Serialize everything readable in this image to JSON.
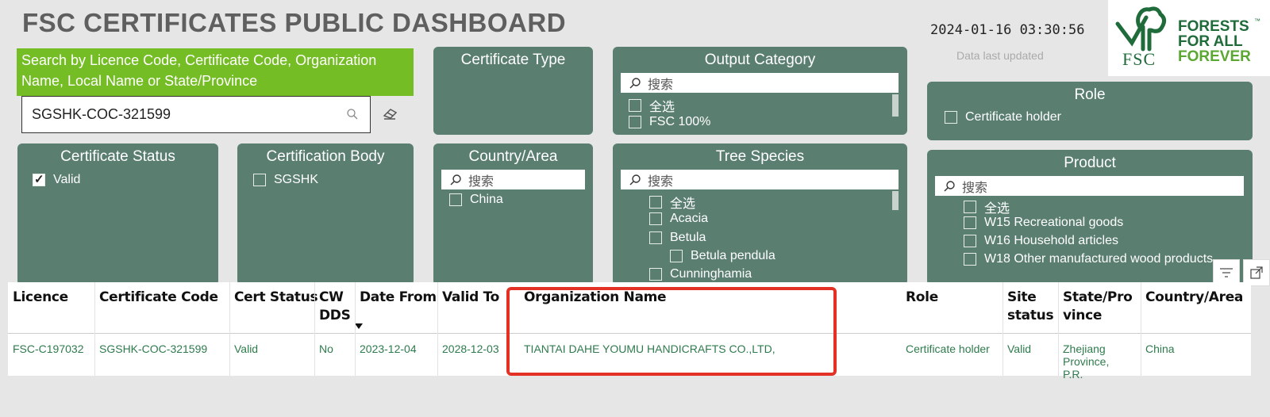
{
  "header": {
    "title": "FSC CERTIFICATES PUBLIC DASHBOARD",
    "timestamp": "2024-01-16 03:30:56",
    "updated_label": "Data last updated"
  },
  "logo": {
    "fsc": "FSC",
    "slogan_1": "FORESTS",
    "slogan_2": "FOR ALL",
    "slogan_3": "FOREVER",
    "tm": "™"
  },
  "search": {
    "banner": "Search by Licence Code, Certificate Code, Organization Name, Local Name or State/Province",
    "value": "SGSHK-COC-321599"
  },
  "filters": {
    "certificate_type": {
      "title": "Certificate Type"
    },
    "output_category": {
      "title": "Output Category",
      "search_placeholder": "搜索",
      "items": [
        "全选",
        "FSC 100%"
      ]
    },
    "role": {
      "title": "Role",
      "items": [
        "Certificate holder"
      ]
    },
    "certificate_status": {
      "title": "Certificate Status",
      "items": [
        "Valid"
      ]
    },
    "certification_body": {
      "title": "Certification Body",
      "items": [
        "SGSHK"
      ]
    },
    "country_area": {
      "title": "Country/Area",
      "search_placeholder": "搜索",
      "items": [
        "China"
      ]
    },
    "tree_species": {
      "title": "Tree Species",
      "search_placeholder": "搜索",
      "items": [
        "全选",
        "Acacia",
        "Betula",
        "Betula pendula",
        "Cunninghamia"
      ]
    },
    "product": {
      "title": "Product",
      "search_placeholder": "搜索",
      "items": [
        "全选",
        "W15 Recreational goods",
        "W16 Household articles",
        "W18 Other manufactured wood products"
      ]
    }
  },
  "table": {
    "headers": {
      "licence": "Licence",
      "certificate_code": "Certificate Code",
      "cert_status": "Cert Status",
      "cw_dds_1": "CW",
      "cw_dds_2": "DDS",
      "date_from": "Date From",
      "valid_to": "Valid To",
      "organization_name": "Organization Name",
      "role": "Role",
      "site_status_1": "Site",
      "site_status_2": "status",
      "state_1": "State/Pro",
      "state_2": "vince",
      "country_area": "Country/Area"
    },
    "row": {
      "licence": "FSC-C197032",
      "certificate_code": "SGSHK-COC-321599",
      "cert_status": "Valid",
      "cw_dds": "No",
      "date_from": "2023-12-04",
      "valid_to": "2028-12-03",
      "organization_name": "TIANTAI DAHE YOUMU HANDICRAFTS CO.,LTD,",
      "role": "Certificate holder",
      "site_status": "Valid",
      "state_1": "Zhejiang",
      "state_2": "Province,",
      "state_3": "P.R.",
      "country_area": "China"
    }
  }
}
